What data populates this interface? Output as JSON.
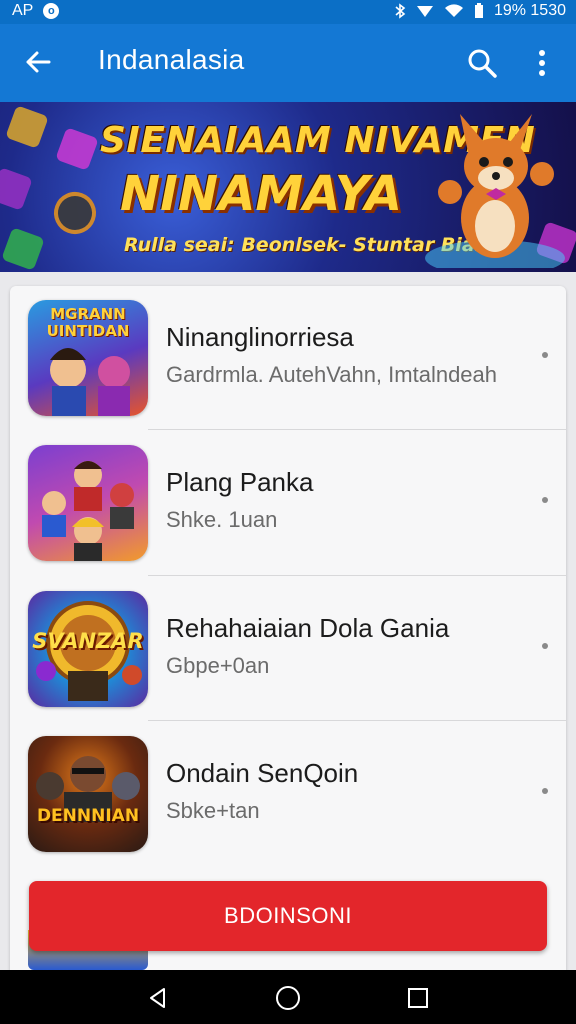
{
  "status_bar": {
    "left_text": "AP",
    "right_text": "19% 1530",
    "colors": {
      "background": "#0b6fc6"
    }
  },
  "toolbar": {
    "title": "Indanalasia",
    "icons": {
      "back": "arrow-left-icon",
      "search": "search-icon",
      "more": "more-vertical-icon"
    },
    "colors": {
      "background": "#1478d4"
    }
  },
  "banner": {
    "headline_line1": "SIENAIAAM NIVAMEN",
    "headline_line2": "NINAMAYA",
    "subline": "Rulla seai: Beonlsek- Stuntar Bialiy",
    "colors": {
      "text": "#ffd23a",
      "background": "#1e2a8a"
    }
  },
  "app_list": [
    {
      "name": "Ninanglinorriesa",
      "meta": "Gardrmla. AutehVahn, Imtalndeah",
      "icon_text": "MGRANN UINTIDAN",
      "icon_colors": [
        "#2a9be0",
        "#e8552a"
      ]
    },
    {
      "name": "Plang Panka",
      "meta": "Shke. 1uan",
      "icon_text": "",
      "icon_colors": [
        "#7b3fd0",
        "#f29b2a"
      ]
    },
    {
      "name": "Rehahaiaian Dola Gania",
      "meta": "Gbpe+0an",
      "icon_text": "SVANZAR",
      "icon_colors": [
        "#1f8ad6",
        "#f0b92c"
      ]
    },
    {
      "name": "Ondain SenQoin",
      "meta": "Sbke+tan",
      "icon_text": "DENNNIAN",
      "icon_colors": [
        "#2a1a14",
        "#e07a1a"
      ]
    }
  ],
  "cta_button": {
    "label": "BDOINSONI",
    "colors": {
      "background": "#e3262b"
    }
  },
  "nav_bar": {
    "icons": {
      "back": "triangle-back-icon",
      "home": "circle-home-icon",
      "recents": "square-recents-icon"
    }
  }
}
